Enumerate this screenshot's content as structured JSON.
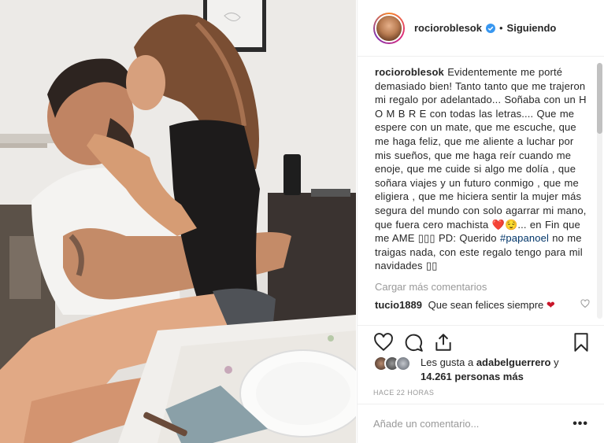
{
  "post": {
    "author": "rocioroblesok",
    "follow_status": "Siguiendo",
    "separator": "•",
    "caption_text_1": "Evidentemente me porté demasiado bien! Tanto tanto que me trajeron mi regalo por adelantado... Soñaba con un H O M B R E con todas las letras.... Que me espere con un mate, que me escuche, que me haga feliz, que me aliente a luchar por mis sueños, que me haga reír cuando me enoje, que me cuide si algo me dolía , que soñara viajes y un futuro conmigo , que me eligiera , que me hiciera sentir la mujer más segura del mundo con solo agarrar mi mano, que fuera cero machista ",
    "caption_emoji_1": "❤️😌",
    "caption_text_2": "... en Fin que me AME ",
    "caption_emoji_2": "▯▯▯",
    "caption_text_3": " PD: Querido ",
    "hashtag": "#papanoel",
    "caption_text_4": " no me traigas nada, con este regalo tengo para mil navidades ",
    "caption_emoji_3": "▯▯"
  },
  "load_more_label": "Cargar más comentarios",
  "comments": [
    {
      "user": "tucio1889",
      "text": "Que sean felices siempre",
      "emoji": "❤"
    }
  ],
  "likes": {
    "prefix": "Les gusta a ",
    "first_user": "adabelguerrero",
    "joiner": " y ",
    "count": "14.261 personas más"
  },
  "timestamp": "Hace 22 horas",
  "add_comment_placeholder": "Añade un comentario...",
  "more_options": "•••",
  "colors": {
    "link": "#003569",
    "heart": "#c9162a",
    "verified": "#3897f0",
    "muted": "#999999"
  },
  "icons": [
    "verified-badge-icon",
    "heart-icon",
    "comment-icon",
    "share-icon",
    "bookmark-icon",
    "small-heart-icon"
  ]
}
